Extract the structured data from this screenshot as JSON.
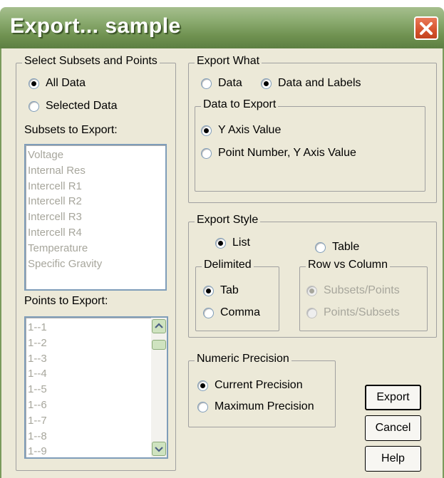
{
  "window": {
    "title": "Export... sample",
    "close_icon": "close-icon"
  },
  "select_subsets": {
    "legend": "Select Subsets and Points",
    "all_data": "All Data",
    "selected_data": "Selected Data",
    "subsets_label": "Subsets to Export:",
    "subsets": [
      "Voltage",
      "Internal Res",
      "Intercell R1",
      "Intercell R2",
      "Intercell R3",
      "Intercell R4",
      "Temperature",
      "Specific Gravity"
    ],
    "points_label": "Points to Export:",
    "points": [
      "1--1",
      "1--2",
      "1--3",
      "1--4",
      "1--5",
      "1--6",
      "1--7",
      "1--8",
      "1--9"
    ]
  },
  "export_what": {
    "legend": "Export What",
    "data": "Data",
    "data_and_labels": "Data and Labels",
    "data_to_export": {
      "legend": "Data to Export",
      "y_axis_value": "Y Axis Value",
      "point_number_y": "Point Number, Y Axis Value"
    }
  },
  "export_style": {
    "legend": "Export Style",
    "list": "List",
    "table": "Table",
    "delimited": {
      "legend": "Delimited",
      "tab": "Tab",
      "comma": "Comma"
    },
    "row_vs_column": {
      "legend": "Row vs Column",
      "subsets_points": "Subsets/Points",
      "points_subsets": "Points/Subsets"
    }
  },
  "numeric_precision": {
    "legend": "Numeric Precision",
    "current": "Current Precision",
    "maximum": "Maximum Precision"
  },
  "buttons": {
    "export": "Export",
    "cancel": "Cancel",
    "help": "Help"
  },
  "colors": {
    "titlebar": "#7a9a5c",
    "dialog_bg": "#ece9d8",
    "close_button": "#d6532d",
    "disabled_text": "#a7a69c"
  }
}
